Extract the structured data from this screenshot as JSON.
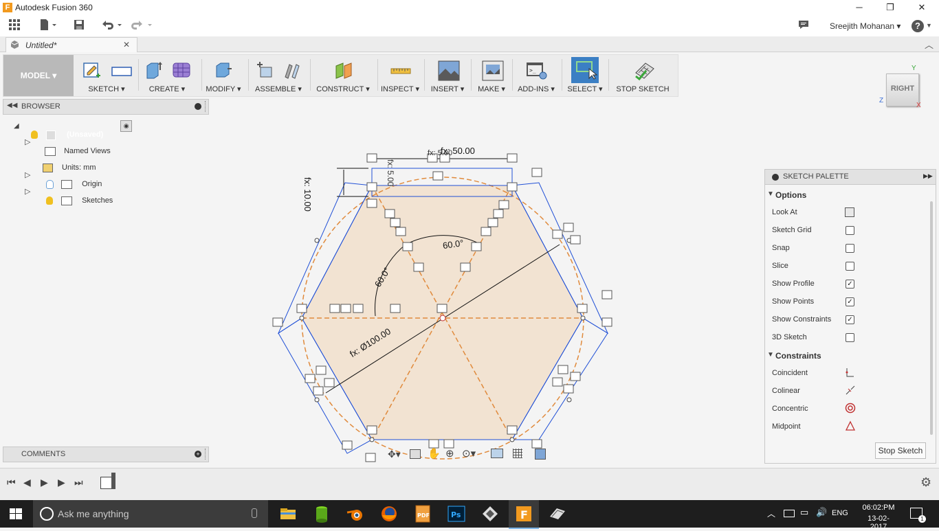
{
  "app": {
    "title": "Autodesk Fusion 360"
  },
  "window_controls": {
    "minimize": "─",
    "maximize": "❐",
    "close": "✕"
  },
  "qat": {
    "user_name": "Sreejith Mohanan ▾",
    "help": "?"
  },
  "doc_tab": {
    "label": "Untitled*",
    "close": "✕",
    "collapse": "︿"
  },
  "toolbar": {
    "model": "MODEL ▾",
    "groups": [
      "SKETCH ▾",
      "CREATE ▾",
      "MODIFY ▾",
      "ASSEMBLE ▾",
      "CONSTRUCT ▾",
      "INSPECT ▾",
      "INSERT ▾",
      "MAKE ▾",
      "ADD-INS ▾",
      "SELECT ▾",
      "STOP SKETCH"
    ]
  },
  "viewcube": {
    "face": "RIGHT",
    "axis_y": "Y",
    "axis_z": "Z",
    "axis_x": "X"
  },
  "browser": {
    "title": "BROWSER",
    "root": "(Unsaved)",
    "items": [
      {
        "label": "Named Views"
      },
      {
        "label": "Units: mm"
      },
      {
        "label": "Origin"
      },
      {
        "label": "Sketches"
      }
    ]
  },
  "comments": {
    "title": "COMMENTS"
  },
  "canvas": {
    "dim_top": "fx: 50.00",
    "dim_top_small": "fx: 5.00",
    "dim_left": "fx: 10.00",
    "dim_left_small": "fx: 5.00",
    "angle_1": "60.0°",
    "angle_2": "60.0°",
    "diameter": "fx: Ø100.00"
  },
  "palette": {
    "title": "SKETCH PALETTE",
    "options_title": "Options",
    "options": [
      {
        "label": "Look At",
        "type": "icon"
      },
      {
        "label": "Sketch Grid",
        "checked": false
      },
      {
        "label": "Snap",
        "checked": false
      },
      {
        "label": "Slice",
        "checked": false
      },
      {
        "label": "Show Profile",
        "checked": true
      },
      {
        "label": "Show Points",
        "checked": true
      },
      {
        "label": "Show Constraints",
        "checked": true
      },
      {
        "label": "3D Sketch",
        "checked": false
      }
    ],
    "constraints_title": "Constraints",
    "constraints": [
      {
        "label": "Coincident",
        "icon": "coincident-icon"
      },
      {
        "label": "Colinear",
        "icon": "colinear-icon"
      },
      {
        "label": "Concentric",
        "icon": "concentric-icon"
      },
      {
        "label": "Midpoint",
        "icon": "midpoint-icon"
      }
    ],
    "stop_button": "Stop Sketch"
  },
  "taskbar": {
    "search_placeholder": "Ask me anything",
    "language": "ENG",
    "time": "06:02:PM",
    "date": "13-02-2017",
    "notification_count": "1"
  },
  "colors": {
    "sketch_line": "#1f4fd6",
    "construction": "#e08a3c",
    "profile_fill": "#f2e3d2",
    "select_blue": "#3b7fc4"
  }
}
